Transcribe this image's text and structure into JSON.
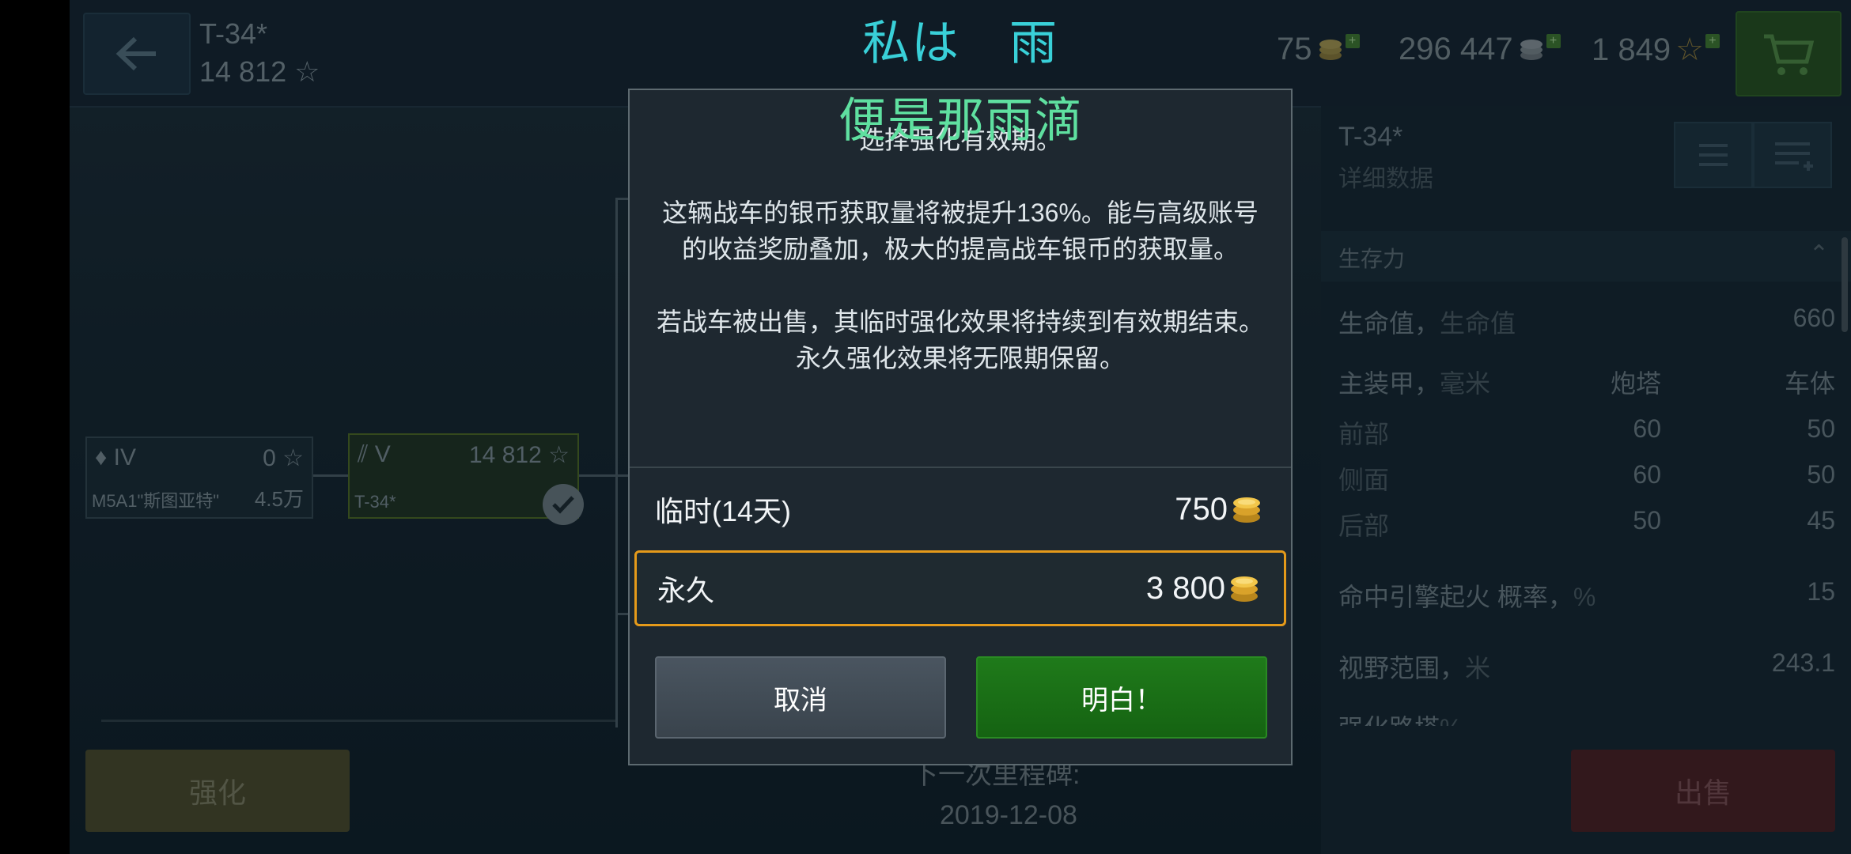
{
  "header": {
    "tank_name": "T-34*",
    "tank_rating": "14 812 ☆",
    "gold": "75",
    "silver": "296 447",
    "free_xp": "1 849"
  },
  "tree": {
    "node1": {
      "tier": "IV",
      "xp": "0 ☆",
      "name": "M5A1\"斯图亚特\"",
      "price": "4.5万"
    },
    "node2": {
      "tier": "V",
      "xp": "14 812 ☆",
      "name": "T-34*"
    }
  },
  "bottom": {
    "upgrade_label": "强化",
    "milestone_label": "下一次里程碑:",
    "milestone_date": "2019-12-08",
    "sell_label": "出售"
  },
  "panel": {
    "title": "T-34*",
    "subtitle": "详细数据",
    "section": "生存力",
    "rows": [
      {
        "label": "生命值，",
        "dim": "生命值",
        "v1": "",
        "v2": "660"
      },
      {
        "label": "主装甲，",
        "dim": "毫米",
        "v1": "炮塔",
        "v2": "车体"
      },
      {
        "label": "前部",
        "dim": "",
        "v1": "60",
        "v2": "50"
      },
      {
        "label": "侧面",
        "dim": "",
        "v1": "60",
        "v2": "50"
      },
      {
        "label": "后部",
        "dim": "",
        "v1": "50",
        "v2": "45"
      },
      {
        "label": "命中引擎起火 概率，",
        "dim": "%",
        "v1": "",
        "v2": "15"
      },
      {
        "label": "视野范围，",
        "dim": "米",
        "v1": "",
        "v2": "243.1"
      },
      {
        "label": "强化路塔",
        "dim": "%",
        "v1": "",
        "v2": ""
      }
    ]
  },
  "dialog": {
    "line1": "选择强化有效期。",
    "para2": "这辆战车的银币获取量将被提升136%。能与高级账号的收益奖励叠加，极大的提高战车银币的获取量。",
    "para3a": "若战车被出售，其临时强化效果将持续到有效期结束。",
    "para3b": "永久强化效果将无限期保留。",
    "option_temp_label": "临时(14天)",
    "option_temp_price": "750",
    "option_perm_label": "永久",
    "option_perm_price": "3 800",
    "cancel_label": "取消",
    "ok_label": "明白！"
  },
  "subtitles": {
    "line1": "私は　雨",
    "line2": "便是那雨滴"
  },
  "colors": {
    "accent_orange": "#e59a1a",
    "ok_green": "#1f7a1a",
    "gold_coin": "#e7b534",
    "subtitle_cyan": "#39d0d8",
    "subtitle_green": "#5fe0a0"
  }
}
